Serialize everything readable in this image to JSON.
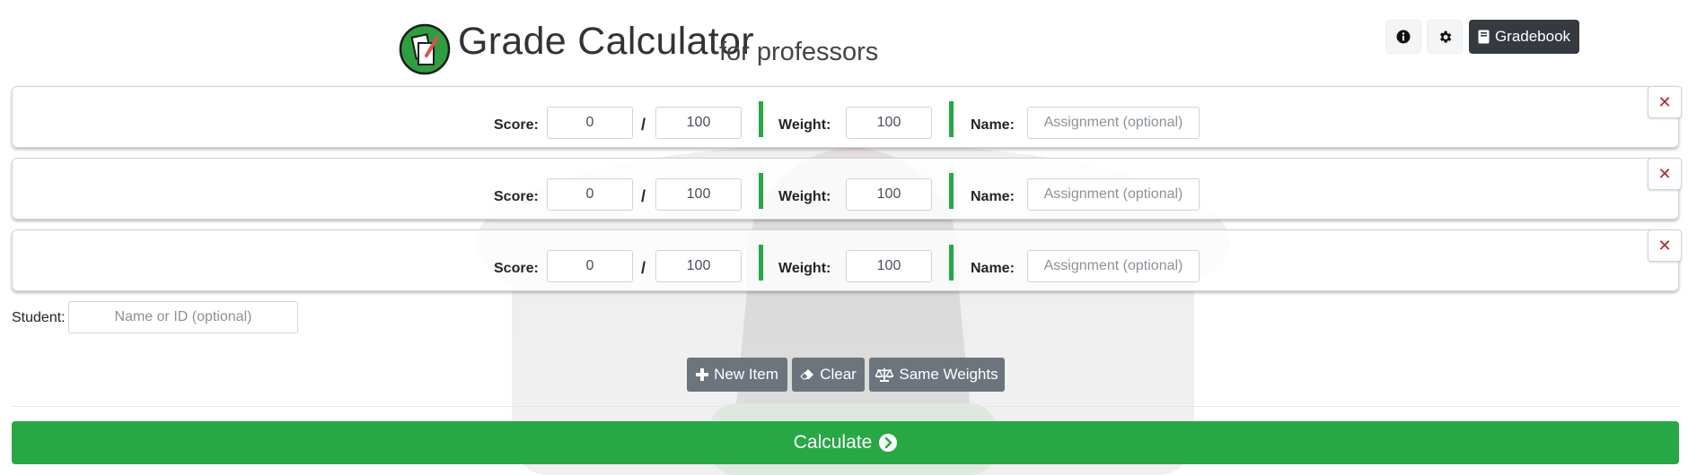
{
  "header": {
    "title": "Grade Calculator",
    "subtitle": "for professors",
    "gradebook_label": "Gradebook"
  },
  "rows": [
    {
      "score_label": "Score:",
      "score": "0",
      "separator": "/",
      "total": "100",
      "weight_label": "Weight:",
      "weight": "100",
      "name_label": "Name:",
      "name_placeholder": "Assignment (optional)",
      "remove": "✕"
    },
    {
      "score_label": "Score:",
      "score": "0",
      "separator": "/",
      "total": "100",
      "weight_label": "Weight:",
      "weight": "100",
      "name_label": "Name:",
      "name_placeholder": "Assignment (optional)",
      "remove": "✕"
    },
    {
      "score_label": "Score:",
      "score": "0",
      "separator": "/",
      "total": "100",
      "weight_label": "Weight:",
      "weight": "100",
      "name_label": "Name:",
      "name_placeholder": "Assignment (optional)",
      "remove": "✕"
    }
  ],
  "student": {
    "label": "Student:",
    "placeholder": "Name or ID (optional)"
  },
  "actions": {
    "new_item": "New Item",
    "clear": "Clear",
    "same_weights": "Same Weights"
  },
  "calculate": "Calculate",
  "icons": {
    "info": "info-circle-icon",
    "settings": "gear-icon",
    "gradebook": "book-icon",
    "remove": "close-icon",
    "new_item": "plus-icon",
    "clear": "eraser-icon",
    "same_weights": "balance-scale-icon",
    "calculate": "chevron-circle-right-icon"
  },
  "colors": {
    "accent_green": "#28a745",
    "secondary_button": "#6c757d",
    "dark_button": "#343a40",
    "remove_red": "#b51f2a"
  }
}
